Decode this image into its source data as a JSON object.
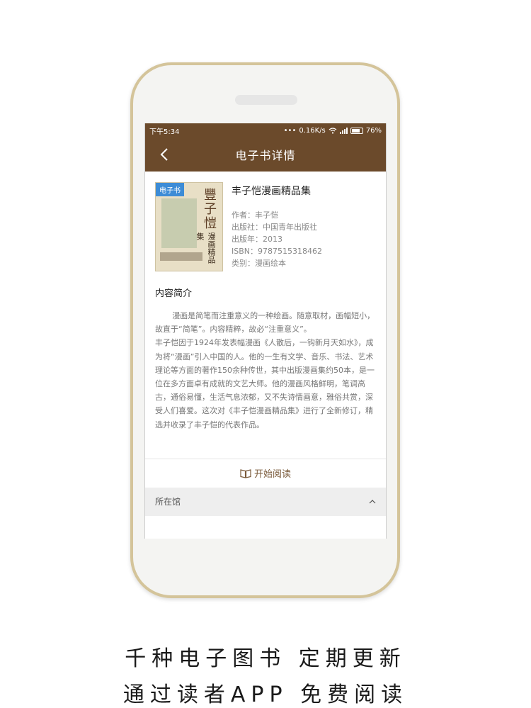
{
  "status_bar": {
    "time": "下午5:34",
    "network_speed": "0.16K/s",
    "battery": "76%",
    "battery_level": 0.76
  },
  "nav": {
    "title": "电子书详情",
    "back_icon": "chevron-left-icon"
  },
  "book": {
    "tag": "电子书",
    "title": "丰子恺漫画精品集",
    "cover_title": "豐子愷",
    "cover_subtitle": "漫画精品集",
    "author": "作者：丰子恺",
    "publisher": "出版社：中国青年出版社",
    "year": "出版年：2013",
    "isbn": "ISBN：9787515318462",
    "category": "类别：漫画绘本"
  },
  "summary": {
    "heading": "内容简介",
    "paragraph1": "漫画是简笔而注重意义的一种绘画。随意取材，画幅短小，故直于“简笔”。内容精粹，故必“注重意义”。",
    "paragraph2": "丰子恺因于1924年发表幅漫画《人散后，一钩新月天如水》，成为将“漫画”引入中国的人。他的一生有文学、音乐、书法、艺术理论等方面的著作150余种传世，其中出版漫画集约50本，是一位在多方面卓有成就的文艺大师。他的漫画风格鲜明，笔调高古，通俗易懂，生活气息浓郁，又不失诗情画意，雅俗共赏，深受人们喜爱。这次对《丰子恺漫画精品集》进行了全新修订，精选并收录了丰子恺的代表作品。"
  },
  "actions": {
    "read_label": "开始阅读",
    "read_icon": "book-icon",
    "library_label": "所在馆",
    "library_icon": "chevron-up-icon"
  },
  "captions": {
    "line1": "千种电子图书 定期更新",
    "line2": "通过读者APP 免费阅读"
  },
  "colors": {
    "header_brown": "#6b4a2b",
    "tag_blue": "#3d8cd6",
    "phone_gold": "#d4c49a"
  }
}
